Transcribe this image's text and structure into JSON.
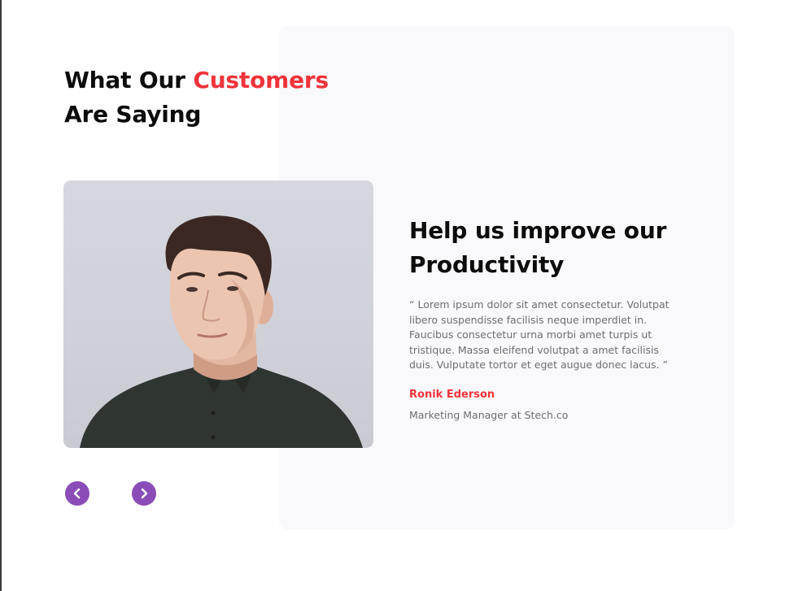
{
  "section": {
    "title_prefix": "What Our ",
    "title_accent": "Customers",
    "title_suffix": "Are Saying"
  },
  "testimonial": {
    "heading": "Help us improve our Productivity",
    "quote": "“ Lorem ipsum dolor sit amet consectetur. Volutpat libero suspendisse facilisis neque imperdiet in. Faucibus consectetur urna morbi amet turpis ut tristique. Massa eleifend volutpat a amet facilisis duis. Vulputate tortor et eget augue donec lacus. ”",
    "author_name": "Ronik Ederson",
    "author_role": "Marketing Manager at Stech.co",
    "photo_icon": "person-portrait"
  },
  "navigation": {
    "prev_icon": "chevron-left-icon",
    "next_icon": "chevron-right-icon"
  },
  "colors": {
    "accent": "#f0333a",
    "nav_button": "#8a4db7",
    "card_background": "#f9f9fb",
    "heading": "#0c0c0c",
    "body_text": "#6d6d74"
  }
}
